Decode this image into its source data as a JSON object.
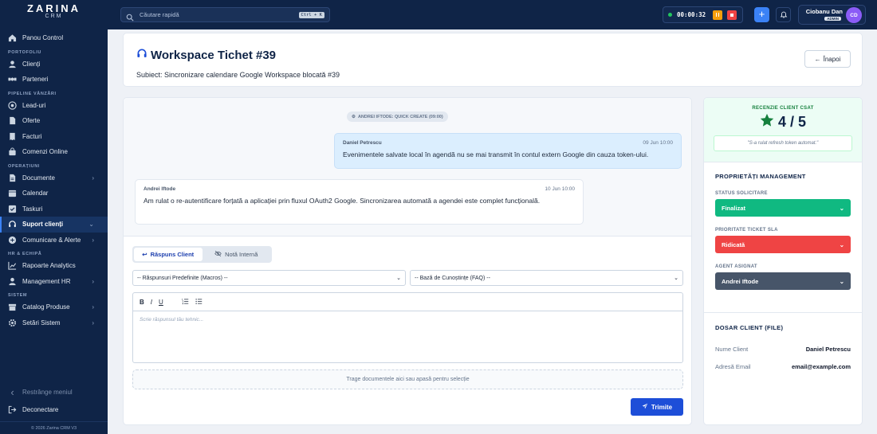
{
  "brand": {
    "name": "ZARINA",
    "sub": "CRM"
  },
  "sidebar": {
    "items": [
      {
        "label": "Panou Control"
      },
      {
        "section": "PORTOFOLIU"
      },
      {
        "label": "Clienți"
      },
      {
        "label": "Parteneri"
      },
      {
        "section": "PIPELINE VÂNZĂRI"
      },
      {
        "label": "Lead-uri"
      },
      {
        "label": "Oferte"
      },
      {
        "label": "Facturi"
      },
      {
        "label": "Comenzi Online"
      },
      {
        "section": "OPERAȚIUNI"
      },
      {
        "label": "Documente"
      },
      {
        "label": "Calendar"
      },
      {
        "label": "Taskuri"
      },
      {
        "label": "Suport clienți"
      },
      {
        "label": "Comunicare & Alerte"
      },
      {
        "section": "HR & ECHIPĂ"
      },
      {
        "label": "Rapoarte Analytics"
      },
      {
        "label": "Management HR"
      },
      {
        "section": "SISTEM"
      },
      {
        "label": "Catalog Produse"
      },
      {
        "label": "Setări Sistem"
      }
    ],
    "collapse_label": "Restrânge meniul",
    "logout_label": "Deconectare",
    "copyright": "© 2026 Zarina CRM V3"
  },
  "topbar": {
    "search_placeholder": "Căutare rapidă",
    "search_shortcut": "Ctrl + K",
    "timer": "00:00:32",
    "user_name": "Ciobanu Dan",
    "user_role": "ADMIN",
    "user_initials": "CD"
  },
  "ticket": {
    "title": "Workspace Tichet #39",
    "subject": "Subiect: Sincronizare calendare Google Workspace blocată #39",
    "back_label": "Înapoi"
  },
  "conversation": {
    "system_note": "ANDREI IFTODE: QUICK CREATE (09:00)",
    "messages": [
      {
        "author": "Daniel Petrescu",
        "time": "09 Jun 10:00",
        "text": "Evenimentele salvate local în agendă nu se mai transmit în contul extern Google din cauza token-ului."
      },
      {
        "author": "Andrei Iftode",
        "time": "10 Jun 10:00",
        "text": "Am rulat o re-autentificare forțată a aplicației prin fluxul OAuth2 Google. Sincronizarea automată a agendei este complet funcțională."
      }
    ]
  },
  "reply": {
    "tab_client": "Răspuns Client",
    "tab_internal": "Notă Internă",
    "macros_select": "-- Răspunsuri Predefinite (Macros) --",
    "kb_select": "-- Bază de Cunoștințe (FAQ) --",
    "editor_placeholder": "Scrie răspunsul tău tehnic...",
    "dropzone": "Trage documentele aici sau apasă pentru selecție",
    "send_label": "Trimite"
  },
  "csat": {
    "label": "RECENZIE CLIENT CSAT",
    "score": "4 / 5",
    "quote": "\"S-a rulat refresh token automat.\""
  },
  "management": {
    "title": "PROPRIETĂȚI MANAGEMENT",
    "status_label": "STATUS SOLICITARE",
    "status_value": "Finalizat",
    "priority_label": "PRIORITATE TICKET SLA",
    "priority_value": "Ridicată",
    "agent_label": "AGENT ASIGNAT",
    "agent_value": "Andrei Iftode"
  },
  "client_file": {
    "title": "DOSAR CLIENT (FILE)",
    "name_key": "Nume Client",
    "name_value": "Daniel Petrescu",
    "email_key": "Adresă Email",
    "email_value": "email@example.com"
  },
  "colors": {
    "accent": "#1d4ed8",
    "sidebar": "#0f2447",
    "success": "#10b981",
    "danger": "#ef4444"
  }
}
